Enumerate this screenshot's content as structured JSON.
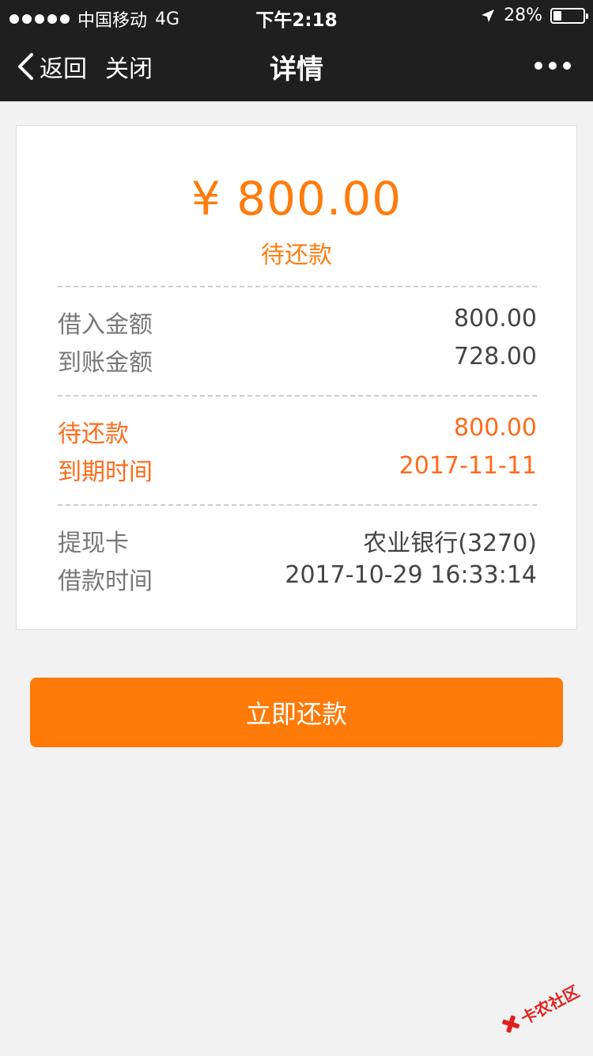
{
  "status_bar": {
    "carrier": "中国移动",
    "network": "4G",
    "time": "下午2:18",
    "battery": "28%",
    "battery_level": 0.28
  },
  "nav": {
    "back_label": "返回",
    "close_label": "关闭",
    "title": "详情"
  },
  "card": {
    "amount": "¥ 800.00",
    "status": "待还款",
    "rows": [
      {
        "label": "借入金额",
        "value": "800.00"
      },
      {
        "label": "到账金额",
        "value": "728.00"
      },
      {
        "label": "待还款",
        "value": "800.00"
      },
      {
        "label": "到期时间",
        "value": "2017-11-11"
      },
      {
        "label": "提现卡",
        "value": "农业银行(3270)"
      },
      {
        "label": "借款时间",
        "value": "2017-10-29 16:33:14"
      }
    ]
  },
  "button": {
    "label": "立即还款"
  },
  "watermark": {
    "text": "卡农社区"
  },
  "colors": {
    "accent": "#ff7c0d",
    "highlight": "#ff6a1a",
    "topbar": "#1f1f1f",
    "background": "#f2f2f2"
  }
}
